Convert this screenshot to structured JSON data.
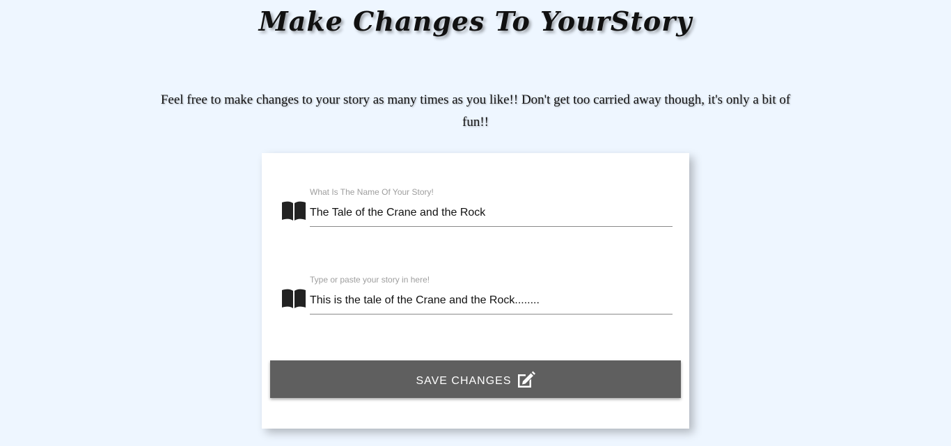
{
  "header": {
    "title": "Make Changes To YourStory"
  },
  "intro": {
    "text": "Feel free to make changes to your story as many times as you like!! Don't get too carried away though, it's only a bit of fun!!"
  },
  "form": {
    "story_name": {
      "label": "What Is The Name Of Your Story!",
      "value": "The Tale of the Crane and the Rock",
      "icon": "book-icon"
    },
    "story_body": {
      "label": "Type or paste your story in here!",
      "value": "This is the tale of the Crane and the Rock........",
      "icon": "book-icon"
    },
    "save_button": {
      "label": "Save Changes",
      "icon": "edit-icon",
      "color": "#5f5f5f"
    }
  },
  "colors": {
    "background": "#eef6ff",
    "card": "#ffffff"
  }
}
